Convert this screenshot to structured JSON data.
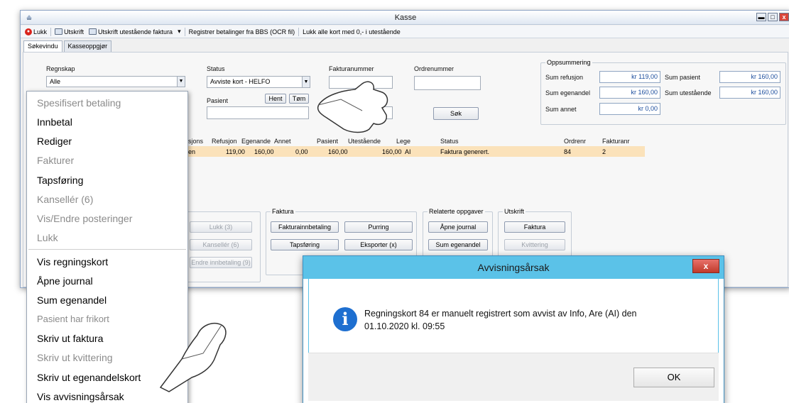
{
  "window": {
    "title": "Kasse"
  },
  "toolbar": {
    "lukk": "Lukk",
    "utskrift": "Utskrift",
    "utskrift_utestaende": "Utskrift utestående faktura",
    "dropdown_arrow": "▾",
    "registrer": "Registrer betalinger fra BBS (OCR fil)",
    "lukk_alle": "Lukk alle kort med 0,- i utestående"
  },
  "tabs": [
    "Søkevindu",
    "Kasseoppgjør"
  ],
  "search": {
    "regnskap_label": "Regnskap",
    "regnskap_value": "Alle",
    "status_label": "Status",
    "status_value": "Avviste kort - HELFO",
    "fakturanummer_label": "Fakturanummer",
    "ordrenummer_label": "Ordrenummer",
    "pasient_label": "Pasient",
    "hent": "Hent",
    "tom": "Tøm",
    "sok": "Søk"
  },
  "summary": {
    "title": "Oppsummering",
    "sum_refusjon_label": "Sum refusjon",
    "sum_refusjon": "kr 119,00",
    "sum_pasient_label": "Sum pasient",
    "sum_pasient": "kr 160,00",
    "sum_egenandel_label": "Sum egenandel",
    "sum_egenandel": "kr 160,00",
    "sum_utestaende_label": "Sum utestående",
    "sum_utestaende": "kr 160,00",
    "sum_annet_label": "Sum annet",
    "sum_annet": "kr 0,00"
  },
  "table": {
    "headers": [
      "usjons",
      "Refusjon",
      "Egenande",
      "Annet",
      "Pasient",
      "Utestående",
      "Lege",
      "Status",
      "Ordrenr",
      "Fakturanr"
    ],
    "row": [
      "en",
      "119,00",
      "160,00",
      "0,00",
      "160,00",
      "160,00",
      "AI",
      "Faktura generert.",
      "84",
      "2"
    ]
  },
  "groups": {
    "faktura_title": "Faktura",
    "relaterte_title": "Relaterte oppgaver",
    "utskrift_title": "Utskrift"
  },
  "buttons": {
    "lukk": "Lukk (3)",
    "kanseller": "Kansellér (6)",
    "endre_innbetaling": "Endre innbetaling (9)",
    "fakturainnbetaling": "Fakturainnbetaling",
    "purring": "Purring",
    "tapsforing": "Tapsføring",
    "eksporter": "Eksporter (x)",
    "apne_journal": "Åpne journal",
    "sum_egenandel": "Sum egenandel",
    "faktura": "Faktura",
    "kvittering": "Kvittering"
  },
  "menu": {
    "items": [
      {
        "label": "Spesifisert betaling",
        "enabled": false
      },
      {
        "label": "Innbetal",
        "enabled": true
      },
      {
        "label": "Rediger",
        "enabled": true
      },
      {
        "label": "Fakturer",
        "enabled": false
      },
      {
        "label": "Tapsføring",
        "enabled": true
      },
      {
        "label": "Kansellér (6)",
        "enabled": false
      },
      {
        "label": "Vis/Endre posteringer",
        "enabled": false
      },
      {
        "label": "Lukk",
        "enabled": false
      },
      {
        "label": "Vis regningskort",
        "enabled": true
      },
      {
        "label": "Åpne journal",
        "enabled": true
      },
      {
        "label": "Sum egenandel",
        "enabled": true
      },
      {
        "label": "Pasient har frikort",
        "enabled": false
      },
      {
        "label": "Skriv ut faktura",
        "enabled": true
      },
      {
        "label": "Skriv ut kvittering",
        "enabled": false
      },
      {
        "label": "Skriv ut egenandelskort",
        "enabled": true
      },
      {
        "label": "Vis avvisningsårsak",
        "enabled": true
      }
    ]
  },
  "dialog": {
    "title": "Avvisningsårsak",
    "message_line1": "Regningskort 84 er manuelt registrert som avvist av Info, Are (AI) den",
    "message_line2": "01.10.2020 kl. 09:55",
    "ok": "OK",
    "close": "x",
    "info_glyph": "i"
  },
  "window_controls": {
    "minimize": "▬",
    "maximize": "□",
    "close": "x"
  }
}
